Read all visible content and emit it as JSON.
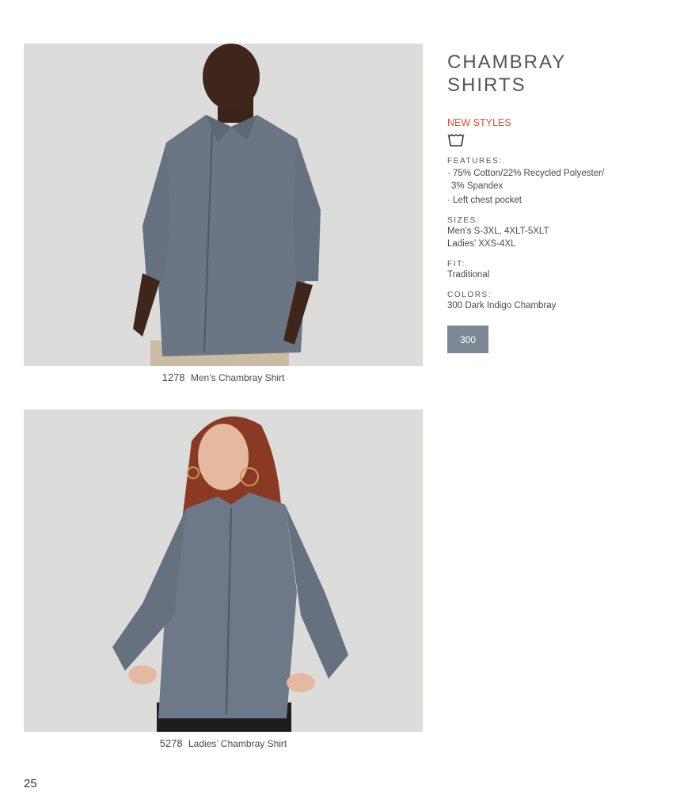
{
  "products": [
    {
      "number": "1278",
      "name": "Men’s Chambray Shirt"
    },
    {
      "number": "5278",
      "name": "Ladies’ Chambray Shirt"
    }
  ],
  "info": {
    "title_line1": "CHAMBRAY",
    "title_line2": "SHIRTS",
    "new_styles": "NEW STYLES",
    "care_icon": "wash-tub-icon",
    "features_label": "FEATURES:",
    "features": [
      {
        "line1": "· 75% Cotton/22% Recycled Polyester/",
        "line2": "3% Spandex"
      },
      {
        "line1": "· Left chest pocket",
        "line2": ""
      }
    ],
    "sizes_label": "SIZES:",
    "sizes": [
      "Men’s S-3XL, 4XLT-5XLT",
      "Ladies’ XXS-4XL"
    ],
    "fit_label": "FIT:",
    "fit": "Traditional",
    "colors_label": "COLORS:",
    "color_name": "300 Dark Indigo Chambray",
    "swatch_label": "300",
    "swatch_color": "#7d8896",
    "accent_color": "#e2512a"
  },
  "page_number": "25"
}
